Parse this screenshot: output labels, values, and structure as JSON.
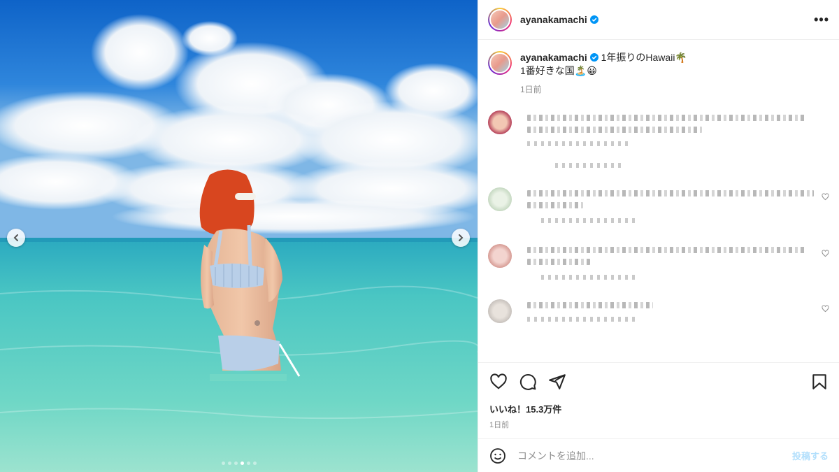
{
  "post": {
    "username": "ayanakamachi",
    "caption_line1": "1年振りのHawaii🌴",
    "caption_line2": "1番好きな国🏝️😀",
    "caption_time": "1日前",
    "likes": "いいね！15.3万件",
    "time": "1日前",
    "more_label": "•••"
  },
  "media": {
    "slides": 6,
    "active_slide": 4
  },
  "comment_box": {
    "placeholder": "コメントを追加...",
    "post_label": "投稿する"
  },
  "icons": {
    "like": "heart-icon",
    "comment": "comment-icon",
    "share": "send-icon",
    "save": "bookmark-icon",
    "emoji": "emoji-icon",
    "prev": "chevron-left-icon",
    "next": "chevron-right-icon",
    "verified": "verified-badge-icon"
  },
  "colors": {
    "verified": "#0095f6",
    "post_button": "#b2dffc",
    "muted": "#8e8e8e"
  }
}
